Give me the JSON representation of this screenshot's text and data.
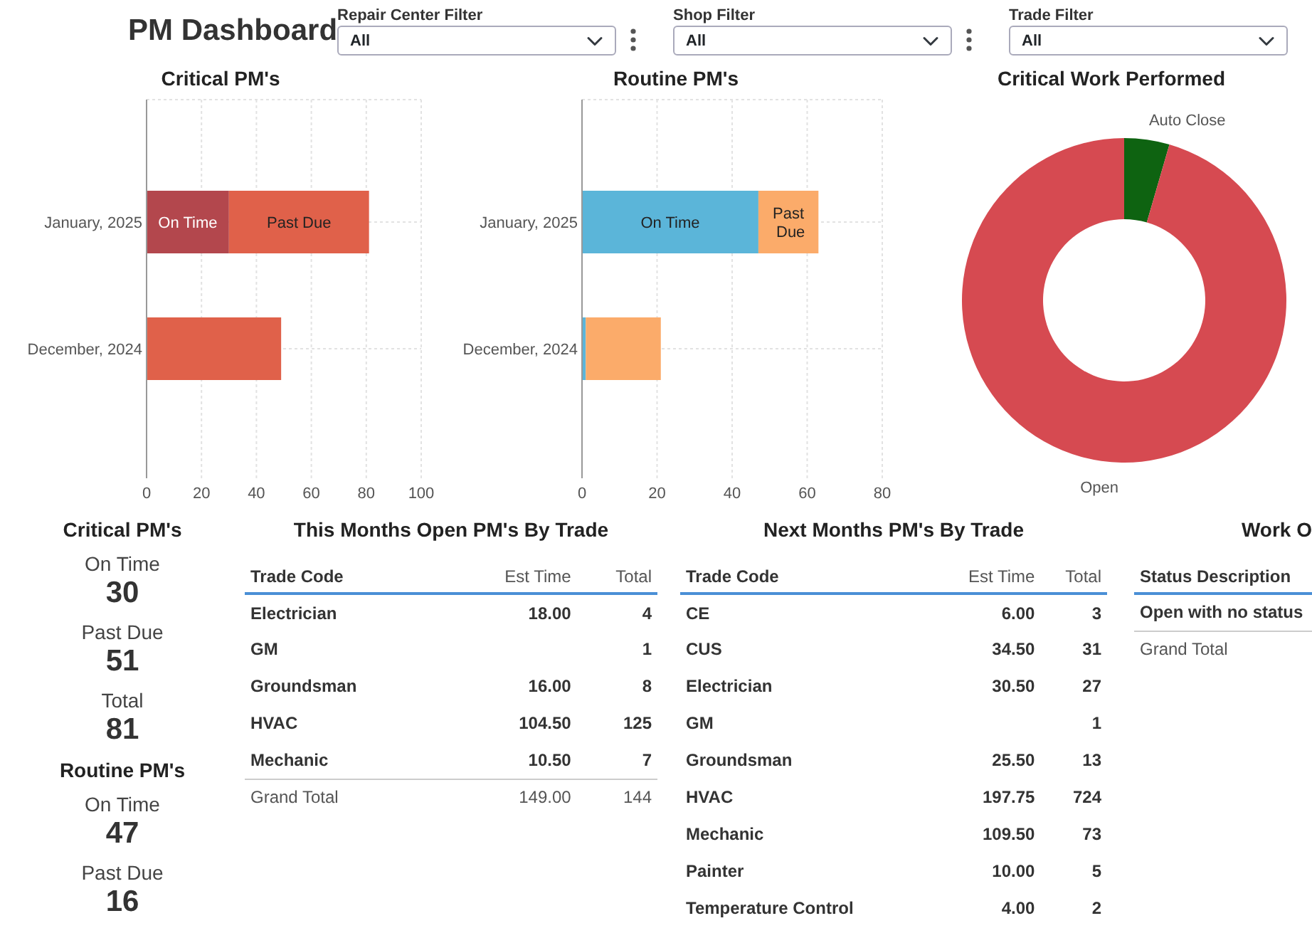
{
  "title": "PM Dashboard",
  "filters": [
    {
      "label": "Repair Center Filter",
      "value": "All",
      "menu": true
    },
    {
      "label": "Shop Filter",
      "value": "All",
      "menu": true
    },
    {
      "label": "Trade Filter",
      "value": "All",
      "menu": false
    }
  ],
  "charts": [
    {
      "title": "Critical PM's",
      "chart_data": {
        "type": "bar",
        "orientation": "horizontal",
        "stacked": true,
        "grid": true,
        "categories": [
          "January, 2025",
          "December, 2024"
        ],
        "xlim": [
          0,
          100
        ],
        "xticks": [
          0,
          20,
          40,
          60,
          80,
          100
        ],
        "series": [
          {
            "color": "#b3474d",
            "values": [
              30,
              0
            ],
            "value_labels": [
              "On Time",
              null
            ]
          },
          {
            "color": "#e0614a",
            "values": [
              51,
              49
            ],
            "value_labels": [
              "Past Due",
              null
            ]
          }
        ]
      }
    },
    {
      "title": "Routine PM's",
      "chart_data": {
        "type": "bar",
        "orientation": "horizontal",
        "stacked": true,
        "grid": true,
        "categories": [
          "January, 2025",
          "December, 2024"
        ],
        "xlim": [
          0,
          80
        ],
        "xticks": [
          0,
          20,
          40,
          60,
          80
        ],
        "series": [
          {
            "color": "#5bb5d9",
            "values": [
              47,
              1
            ],
            "value_labels": [
              "On Time",
              null
            ]
          },
          {
            "color": "#fbab6a",
            "values": [
              16,
              20
            ],
            "value_labels": [
              "Past Due",
              null
            ]
          }
        ]
      }
    },
    {
      "title": "Critical Work Performed",
      "chart_data": {
        "type": "donut",
        "categories": [
          "Auto Close",
          "Open"
        ],
        "series": [
          {
            "colors": [
              "#0e6311",
              "#d64a51"
            ],
            "values": [
              4.5,
              95.5
            ]
          }
        ]
      }
    }
  ],
  "stats": [
    {
      "heading": "Critical PM's",
      "items": [
        {
          "label": "On Time",
          "value": "30"
        },
        {
          "label": "Past Due",
          "value": "51"
        },
        {
          "label": "Total",
          "value": "81"
        }
      ]
    },
    {
      "heading": "Routine PM's",
      "items": [
        {
          "label": "On Time",
          "value": "47"
        },
        {
          "label": "Past Due",
          "value": "16"
        }
      ]
    }
  ],
  "tables": [
    {
      "title": "This Months Open PM's By Trade",
      "columns": [
        "Trade Code",
        "Est Time",
        "Total"
      ],
      "rows": [
        [
          "Electrician",
          "18.00",
          "4"
        ],
        [
          "GM",
          "",
          "1"
        ],
        [
          "Groundsman",
          "16.00",
          "8"
        ],
        [
          "HVAC",
          "104.50",
          "125"
        ],
        [
          "Mechanic",
          "10.50",
          "7"
        ]
      ],
      "total": [
        "Grand Total",
        "149.00",
        "144"
      ]
    },
    {
      "title": "Next Months PM's By Trade",
      "columns": [
        "Trade Code",
        "Est Time",
        "Total"
      ],
      "rows": [
        [
          "CE",
          "6.00",
          "3"
        ],
        [
          "CUS",
          "34.50",
          "31"
        ],
        [
          "Electrician",
          "30.50",
          "27"
        ],
        [
          "GM",
          "",
          "1"
        ],
        [
          "Groundsman",
          "25.50",
          "13"
        ],
        [
          "HVAC",
          "197.75",
          "724"
        ],
        [
          "Mechanic",
          "109.50",
          "73"
        ],
        [
          "Painter",
          "10.00",
          "5"
        ],
        [
          "Temperature Control",
          "4.00",
          "2"
        ]
      ]
    },
    {
      "title": "Work O",
      "columns": [
        "Status Description"
      ],
      "rows": [
        [
          "Open with no status"
        ]
      ],
      "total": [
        "Grand Total"
      ]
    }
  ]
}
